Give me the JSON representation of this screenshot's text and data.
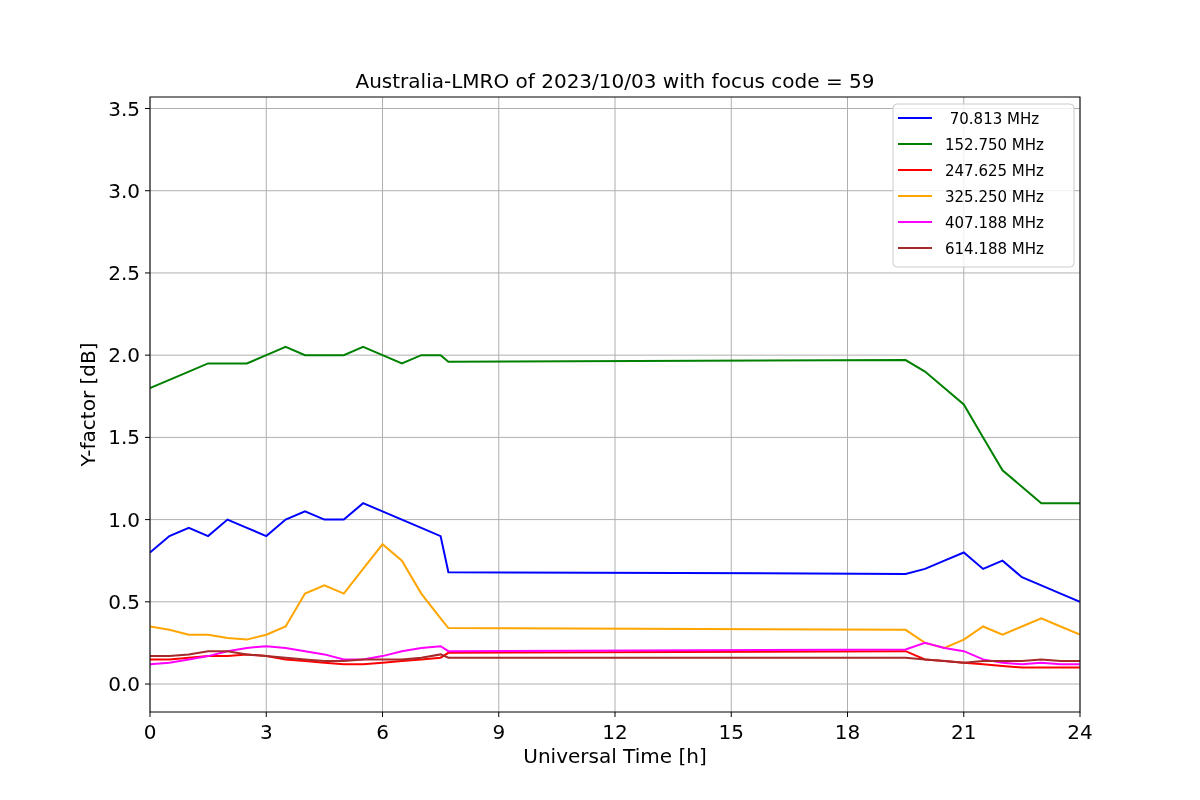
{
  "chart_data": {
    "type": "line",
    "title": "Australia-LMRO of 2023/10/03 with focus code = 59",
    "xlabel": "Universal Time [h]",
    "ylabel": "Y-factor [dB]",
    "x": [
      0,
      0.5,
      1,
      1.5,
      2,
      2.5,
      3,
      3.5,
      4,
      4.5,
      5,
      5.5,
      6,
      6.5,
      7,
      7.5,
      7.7,
      19.5,
      20,
      20.5,
      21,
      21.5,
      22,
      22.5,
      23,
      23.5,
      24
    ],
    "series": [
      {
        "name": " 70.813 MHz",
        "color": "#0000ff",
        "values": [
          0.8,
          0.9,
          0.95,
          0.9,
          1.0,
          0.95,
          0.9,
          1.0,
          1.05,
          1.0,
          1.0,
          1.1,
          1.05,
          1.0,
          0.95,
          0.9,
          0.68,
          0.67,
          0.7,
          0.75,
          0.8,
          0.7,
          0.75,
          0.65,
          0.6,
          0.55,
          0.5
        ]
      },
      {
        "name": "152.750 MHz",
        "color": "#008000",
        "values": [
          1.8,
          1.85,
          1.9,
          1.95,
          1.95,
          1.95,
          2.0,
          2.05,
          2.0,
          2.0,
          2.0,
          2.05,
          2.0,
          1.95,
          2.0,
          2.0,
          1.96,
          1.97,
          1.9,
          1.8,
          1.7,
          1.5,
          1.3,
          1.2,
          1.1,
          1.1,
          1.1
        ]
      },
      {
        "name": "247.625 MHz",
        "color": "#ff0000",
        "values": [
          0.15,
          0.15,
          0.16,
          0.17,
          0.17,
          0.18,
          0.17,
          0.15,
          0.14,
          0.13,
          0.12,
          0.12,
          0.13,
          0.14,
          0.15,
          0.16,
          0.19,
          0.2,
          0.15,
          0.14,
          0.13,
          0.12,
          0.11,
          0.1,
          0.1,
          0.1,
          0.1
        ]
      },
      {
        "name": "325.250 MHz",
        "color": "#ffa500",
        "values": [
          0.35,
          0.33,
          0.3,
          0.3,
          0.28,
          0.27,
          0.3,
          0.35,
          0.55,
          0.6,
          0.55,
          0.7,
          0.85,
          0.75,
          0.55,
          0.4,
          0.34,
          0.33,
          0.25,
          0.22,
          0.27,
          0.35,
          0.3,
          0.35,
          0.4,
          0.35,
          0.3
        ]
      },
      {
        "name": "407.188 MHz",
        "color": "#ff00ff",
        "values": [
          0.12,
          0.13,
          0.15,
          0.17,
          0.2,
          0.22,
          0.23,
          0.22,
          0.2,
          0.18,
          0.15,
          0.15,
          0.17,
          0.2,
          0.22,
          0.23,
          0.2,
          0.21,
          0.25,
          0.22,
          0.2,
          0.15,
          0.13,
          0.12,
          0.13,
          0.12,
          0.12
        ]
      },
      {
        "name": "614.188 MHz",
        "color": "#a52a2a",
        "values": [
          0.17,
          0.17,
          0.18,
          0.2,
          0.2,
          0.18,
          0.17,
          0.16,
          0.15,
          0.14,
          0.14,
          0.15,
          0.15,
          0.15,
          0.16,
          0.18,
          0.16,
          0.16,
          0.15,
          0.14,
          0.13,
          0.14,
          0.14,
          0.14,
          0.15,
          0.14,
          0.14
        ]
      }
    ],
    "grid": true,
    "legend": true,
    "xlim": [
      0,
      24
    ],
    "ylim": [
      -0.17,
      3.57
    ],
    "xticks": [
      0,
      3,
      6,
      9,
      12,
      15,
      18,
      21,
      24
    ],
    "yticks": [
      {
        "value": 0,
        "label": "0.0"
      },
      {
        "value": 0.5,
        "label": "0.5"
      },
      {
        "value": 1,
        "label": "1.0"
      },
      {
        "value": 1.5,
        "label": "1.5"
      },
      {
        "value": 2,
        "label": "2.0"
      },
      {
        "value": 2.5,
        "label": "2.5"
      },
      {
        "value": 3,
        "label": "3.0"
      },
      {
        "value": 3.5,
        "label": "3.5"
      }
    ]
  }
}
